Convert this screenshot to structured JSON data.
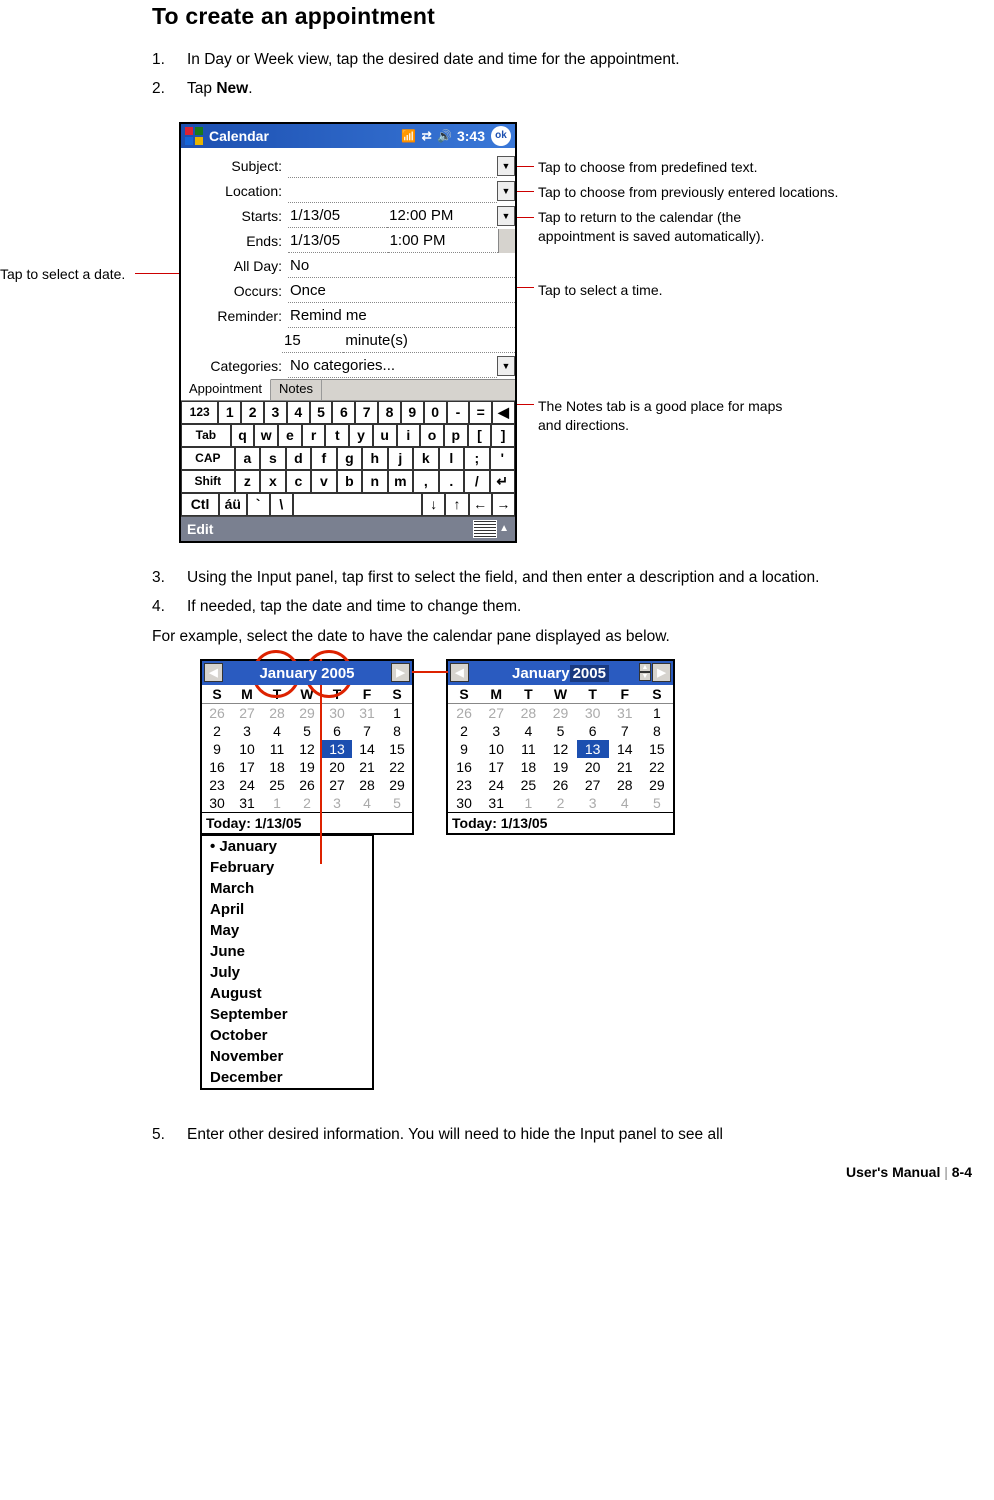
{
  "heading": "To create an appointment",
  "steps": {
    "s1": "In Day or Week view, tap the desired date and time for the appointment.",
    "s2pre": "Tap ",
    "s2b": "New",
    "s2post": ".",
    "s3": "Using the Input panel, tap first to select the field, and then enter a description and a location.",
    "s4": "If needed, tap the date and time to change them.",
    "s4x": "For example, select the date to have the calendar pane displayed as below.",
    "s5": "Enter other desired information. You will need to hide the Input panel to see all"
  },
  "pda": {
    "title": "Calendar",
    "time": "3:43",
    "ok": "ok",
    "labels": {
      "subject": "Subject:",
      "location": "Location:",
      "starts": "Starts:",
      "ends": "Ends:",
      "allday": "All Day:",
      "occurs": "Occurs:",
      "reminder": "Reminder:",
      "categories": "Categories:"
    },
    "values": {
      "starts_date": "1/13/05",
      "starts_time": "12:00 PM",
      "ends_date": "1/13/05",
      "ends_time": "1:00 PM",
      "allday": "No",
      "occurs": "Once",
      "reminder": "Remind me",
      "reminder_n": "15",
      "reminder_u": "minute(s)",
      "categories": "No categories..."
    },
    "tabs": {
      "appointment": "Appointment",
      "notes": "Notes"
    },
    "edit": "Edit",
    "kb": {
      "r1": [
        "123",
        "1",
        "2",
        "3",
        "4",
        "5",
        "6",
        "7",
        "8",
        "9",
        "0",
        "-",
        "=",
        "◀"
      ],
      "r2": [
        "Tab",
        "q",
        "w",
        "e",
        "r",
        "t",
        "y",
        "u",
        "i",
        "o",
        "p",
        "[",
        "]"
      ],
      "r3": [
        "CAP",
        "a",
        "s",
        "d",
        "f",
        "g",
        "h",
        "j",
        "k",
        "l",
        ";",
        "'"
      ],
      "r4": [
        "Shift",
        "z",
        "x",
        "c",
        "v",
        "b",
        "n",
        "m",
        ",",
        ".",
        "/",
        "↵"
      ],
      "r5": [
        "Ctl",
        "áü",
        "`",
        "\\",
        "",
        "",
        "",
        "",
        "",
        "↓",
        "↑",
        "←",
        "→"
      ]
    }
  },
  "callouts": {
    "left": "Tap to select a date.",
    "r1": "Tap to choose from predefined text.",
    "r2": "Tap to choose from previously entered locations.",
    "r3a": "Tap to return to the calendar (the",
    "r3b": "appointment is saved automatically).",
    "r4": "Tap to select a time.",
    "r5a": "The Notes tab is a good place for maps",
    "r5b": "and directions."
  },
  "cal": {
    "hd1": "January 2005",
    "hd2a": "January ",
    "hd2b": "2005",
    "dow": [
      "S",
      "M",
      "T",
      "W",
      "T",
      "F",
      "S"
    ],
    "weeks": [
      [
        "26",
        "27",
        "28",
        "29",
        "30",
        "31",
        "1"
      ],
      [
        "2",
        "3",
        "4",
        "5",
        "6",
        "7",
        "8"
      ],
      [
        "9",
        "10",
        "11",
        "12",
        "13",
        "14",
        "15"
      ],
      [
        "16",
        "17",
        "18",
        "19",
        "20",
        "21",
        "22"
      ],
      [
        "23",
        "24",
        "25",
        "26",
        "27",
        "28",
        "29"
      ],
      [
        "30",
        "31",
        "1",
        "2",
        "3",
        "4",
        "5"
      ]
    ],
    "today": "Today: 1/13/05",
    "months": [
      "January",
      "February",
      "March",
      "April",
      "May",
      "June",
      "July",
      "August",
      "September",
      "October",
      "November",
      "December"
    ]
  },
  "footer": {
    "a": "User's Manual",
    "b": "8-4"
  }
}
